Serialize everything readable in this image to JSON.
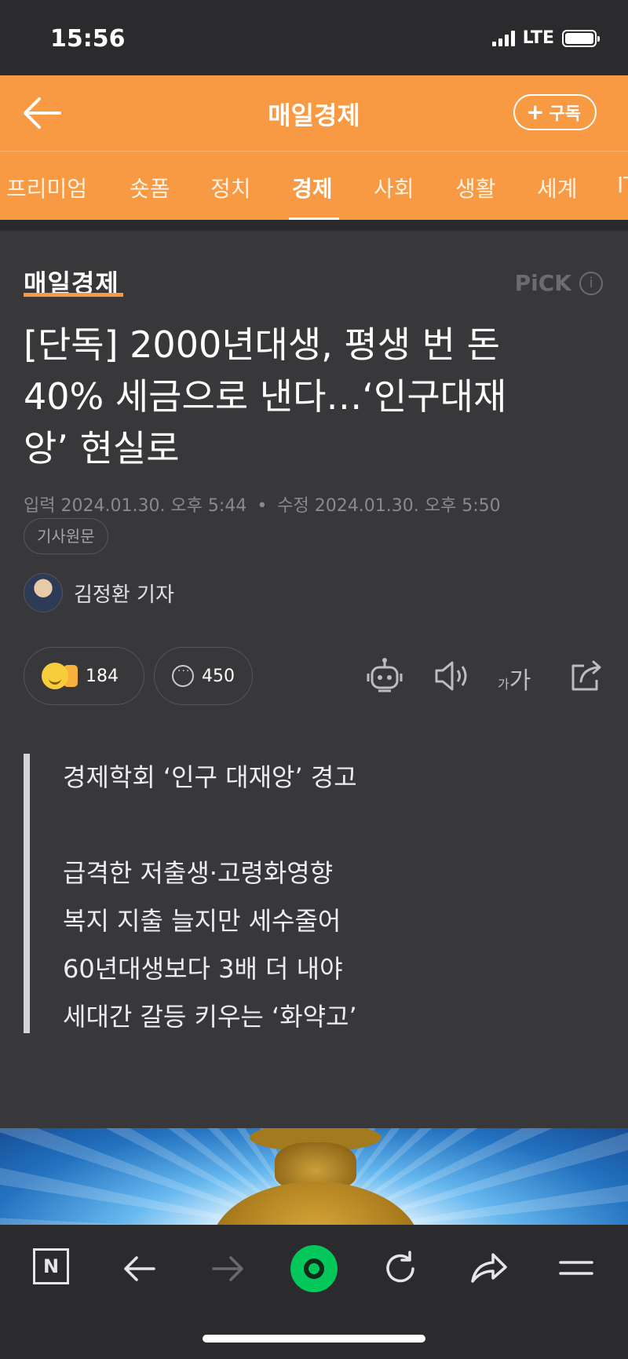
{
  "status_bar": {
    "time": "15:56",
    "network": "LTE",
    "icons": [
      "signal-icon",
      "battery-icon"
    ]
  },
  "header": {
    "title": "매일경제",
    "subscribe_label": "구독",
    "icons": [
      "back-arrow-icon",
      "plus-icon"
    ]
  },
  "tabs": [
    {
      "label": "프리미엄",
      "active": false
    },
    {
      "label": "숏폼",
      "active": false
    },
    {
      "label": "정치",
      "active": false
    },
    {
      "label": "경제",
      "active": true
    },
    {
      "label": "사회",
      "active": false
    },
    {
      "label": "생활",
      "active": false
    },
    {
      "label": "세계",
      "active": false
    },
    {
      "label": "IT",
      "active": false
    }
  ],
  "article": {
    "press": "매일경제",
    "pick": "PiCK",
    "pick_info": "i",
    "headline_lines": [
      "[단독] 2000년대생, 평생 번 돈",
      "40% 세금으로 낸다…‘인구대재",
      "앙’ 현실로"
    ],
    "input_label": "입력",
    "input_time": "2024.01.30. 오후 5:44",
    "edit_label": "수정",
    "edit_time": "2024.01.30. 오후 5:50",
    "original_button": "기사원문",
    "author": "김정환 기자",
    "reaction_count": "184",
    "comment_count": "450",
    "tool_icons": [
      "robot-summary-icon",
      "speaker-icon",
      "font-size-icon",
      "share-icon"
    ],
    "font_size_small": "가",
    "font_size_big": "가",
    "summary": [
      "경제학회 ‘인구 대재앙’ 경고",
      "",
      "급격한 저출생·고령화영향",
      "복지 지출 늘지만 세수줄어",
      "60년대생보다 3배 더 내야",
      "세대간 갈등 키우는 ‘화약고’"
    ]
  },
  "bottom_bar": {
    "n_label": "N",
    "icons": [
      "naver-home-icon",
      "back-icon",
      "forward-icon",
      "green-dot-icon",
      "refresh-icon",
      "share-arrow-icon",
      "menu-icon"
    ]
  },
  "colors": {
    "accent": "#f89a43",
    "background": "#38383b",
    "naver_green": "#03c75a"
  }
}
